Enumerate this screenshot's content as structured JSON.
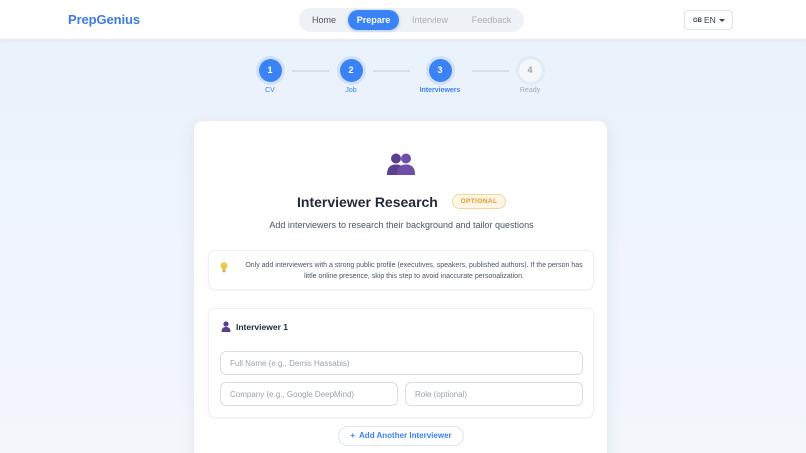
{
  "header": {
    "brand": "PrepGenius",
    "nav": [
      {
        "label": "Home",
        "state": "default"
      },
      {
        "label": "Prepare",
        "state": "active"
      },
      {
        "label": "Interview",
        "state": "disabled"
      },
      {
        "label": "Feedback",
        "state": "disabled"
      }
    ],
    "language": {
      "flag": "GB",
      "code": "EN"
    }
  },
  "stepper": {
    "steps": [
      {
        "number": "1",
        "label": "CV",
        "state": "complete"
      },
      {
        "number": "2",
        "label": "Job",
        "state": "complete"
      },
      {
        "number": "3",
        "label": "Interviewers",
        "state": "current"
      },
      {
        "number": "4",
        "label": "Ready",
        "state": "pending"
      }
    ]
  },
  "card": {
    "icon": "people-icon",
    "title": "Interviewer Research",
    "badge": "OPTIONAL",
    "subtitle": "Add interviewers to research their background and tailor questions",
    "tip": {
      "icon": "lightbulb-icon",
      "text": "Only add interviewers with a strong public profile (executives, speakers, published authors). If the person has little online presence, skip this step to avoid inaccurate personalization."
    },
    "interviewer": {
      "icon": "person-icon",
      "title": "Interviewer 1",
      "full_name": {
        "value": "",
        "placeholder": "Full Name (e.g., Demis Hassabis)"
      },
      "company": {
        "value": "",
        "placeholder": "Company (e.g., Google DeepMind)"
      },
      "role": {
        "value": "",
        "placeholder": "Role (optional)"
      }
    },
    "add_button": {
      "plus": "+",
      "label": "Add Another Interviewer"
    }
  },
  "colors": {
    "accent": "#3b82f6",
    "brand": "#3b7fe0",
    "badge_text": "#e0962a",
    "badge_bg": "#fff6e5",
    "icon_purple": "#5b3f91"
  }
}
